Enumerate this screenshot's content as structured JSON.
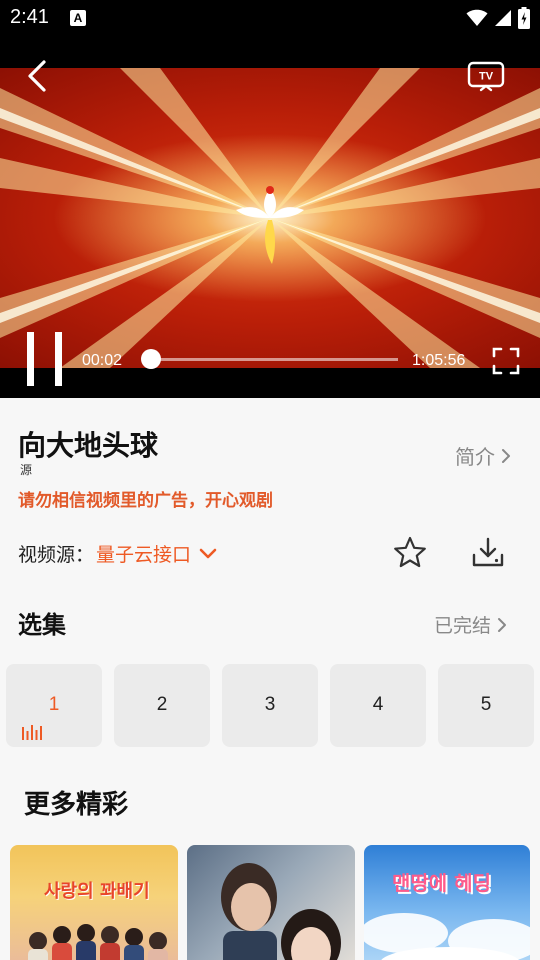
{
  "status_bar": {
    "time": "2:41",
    "notification_icon": "A"
  },
  "player": {
    "current_time": "00:02",
    "total_time": "1:05:56",
    "progress_fraction": 0.0005,
    "cast_icon_label": "TV"
  },
  "info": {
    "title": "向大地头球",
    "source_tag": "源",
    "intro_label": "简介",
    "notice": "请勿相信视频里的广告，开心观剧",
    "source_label": "视频源：",
    "source_value": "量子云接口"
  },
  "episodes": {
    "heading": "选集",
    "status_label": "已完结",
    "items": [
      "1",
      "2",
      "3",
      "4",
      "5"
    ],
    "active_index": 0
  },
  "recommendations": {
    "heading": "更多精彩",
    "items": [
      {
        "poster_text": "사랑의 꽈배기"
      },
      {
        "poster_text": ""
      },
      {
        "poster_text": "맨땅에 헤딩"
      }
    ]
  },
  "colors": {
    "accent": "#ee5a24",
    "notice": "#e25a2a",
    "secondary_text": "#888888",
    "episode_bg": "#ebebeb"
  },
  "icons": [
    "back-arrow-icon",
    "tv-cast-icon",
    "pause-icon",
    "fullscreen-icon",
    "chevron-right-icon",
    "chevron-down-icon",
    "star-icon",
    "download-icon",
    "playing-equalizer-icon",
    "wifi-icon",
    "signal-icon",
    "battery-icon"
  ]
}
